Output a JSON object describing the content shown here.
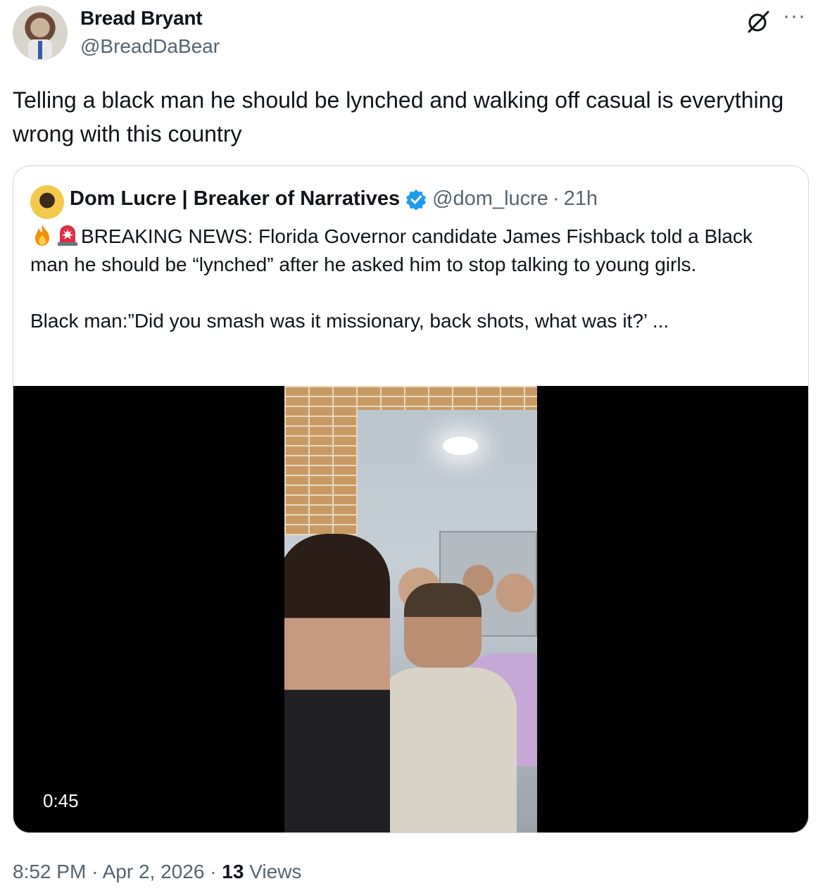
{
  "tweet": {
    "author_name": "Bread Bryant",
    "author_handle": "@BreadDaBear",
    "text": "Telling a black man he should be lynched and walking off casual is everything wrong with this country",
    "time": "8:52 PM",
    "separator": "·",
    "date": "Apr 2, 2026",
    "views_count": "13",
    "views_label": "Views",
    "more_label": "···"
  },
  "quote": {
    "author_name": "Dom Lucre | Breaker of Narratives",
    "author_handle": "@dom_lucre",
    "separator": "·",
    "time": "21h",
    "line1": "BREAKING NEWS: Florida Governor candidate James Fishback told a Black man he should be “lynched” after he asked him to stop talking to young girls.",
    "line2": "Black man:”Did you smash was it missionary, back shots, what was it?’ ...",
    "emojis": [
      "fire-emoji",
      "siren-emoji"
    ],
    "video_duration": "0:45"
  },
  "colors": {
    "text": "#0f1419",
    "secondary": "#536471",
    "border": "#cfd9de",
    "verified": "#1d9bf0"
  }
}
